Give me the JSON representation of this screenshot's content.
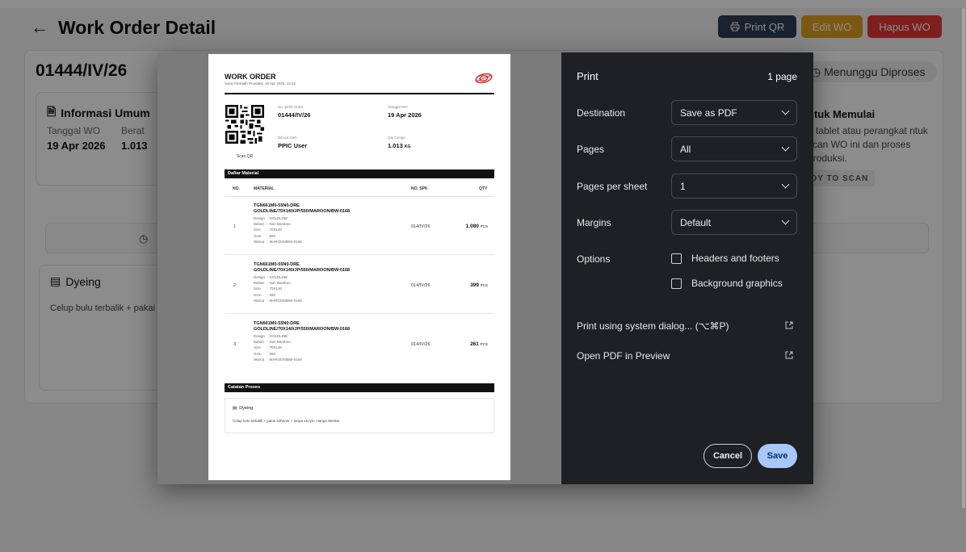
{
  "app": {
    "title": "Work Order Detail",
    "buttons": {
      "print_qr": "Print QR",
      "edit": "Edit WO",
      "hapus": "Hapus WO"
    },
    "wo_number": "01444/IV/26",
    "status": "Menunggu Diproses",
    "info": {
      "title": "Informasi Umum",
      "tanggal_label": "Tanggal WO",
      "tanggal_value": "19 Apr 2026",
      "berat_label": "Berat",
      "berat_value": "1.013"
    },
    "scan_card": {
      "title": "ntuk Memulai",
      "desc": "n tablet atau perangkat ntuk scan WO ini dan proses produksi.",
      "ready": "DY TO SCAN"
    },
    "dyeing": {
      "title": "Dyeing",
      "desc": "Celup bulu terbalik + pakai"
    }
  },
  "sheet": {
    "title": "WORK ORDER",
    "subtitle": "Surat Perintah Produksi, 19 Apr 2026, 13.22",
    "scan_label": "Scan QR",
    "no_wo_label": "No. Work Order",
    "no_wo_value": "01444/IV/26",
    "tanggal_label": "Tanggal WO",
    "tanggal_value": "19 Apr 2026",
    "dibuat_label": "Dibuat Oleh",
    "dibuat_value": "PPIC User",
    "qty_label": "Qty Greige",
    "qty_value": "1.013",
    "qty_unit": "KG",
    "material_section": "Daftar Material",
    "columns": {
      "no": "NO.",
      "material": "MATERIAL",
      "spk": "NO. SPK",
      "qty": "QTY"
    },
    "attr_keys": {
      "design": "Design",
      "bahan": "Bahan",
      "size": "Size",
      "gsm": "Gsm",
      "warna": "Warna"
    },
    "rows": [
      {
        "no": "1",
        "code": "TGN661M0-55N0-DRE",
        "desc": "GOLDLINE/70X140/JP/550/MAROON/BW-0168",
        "design": ": GOLDLINE",
        "bahan": ": Non Bamboo",
        "size": ": 70X140",
        "gsm": ": 550",
        "warna": ": MAROON/BW-0168",
        "spk": "014/IV/26",
        "qty": "1.080",
        "unit": "PCS"
      },
      {
        "no": "2",
        "code": "TGN661M0-55N0-DRE",
        "desc": "GOLDLINE/70X140/JP/550/MAROON/BW-0168",
        "design": ": GOLDLINE",
        "bahan": ": Non Bamboo",
        "size": ": 70X140",
        "gsm": ": 550",
        "warna": ": MAROON/BW-0168",
        "spk": "014/IV/26",
        "qty": "399",
        "unit": "PCS"
      },
      {
        "no": "3",
        "code": "TGN661M0-55N0-DRE",
        "desc": "GOLDLINE/70X140/JP/550/MAROON/BW-0168",
        "design": ": GOLDLINE",
        "bahan": ": Non Bamboo",
        "size": ": 70X140",
        "gsm": ": 550",
        "warna": ": MAROON/BW-0168",
        "spk": "014/IV/26",
        "qty": "261",
        "unit": "PCS"
      }
    ],
    "notes_section": "Catatan Proses",
    "note_title": "Dyeing",
    "note_desc": "Celup bulu terbalik + pakai softener + tanpa enzym +tanpa Stenter"
  },
  "print": {
    "title": "Print",
    "page_count": "1 page",
    "destination_label": "Destination",
    "destination_value": "Save as PDF",
    "pages_label": "Pages",
    "pages_value": "All",
    "pps_label": "Pages per sheet",
    "pps_value": "1",
    "margins_label": "Margins",
    "margins_value": "Default",
    "options_label": "Options",
    "opt_headers": "Headers and footers",
    "opt_background": "Background graphics",
    "headers_checked": false,
    "background_checked": false,
    "system_dialog": "Print using system dialog... (⌥⌘P)",
    "open_preview": "Open PDF in Preview",
    "cancel": "Cancel",
    "save": "Save"
  },
  "colors": {
    "btn_print_qr": "#2f3e55",
    "btn_edit": "#e0a020",
    "btn_hapus": "#e53935",
    "dialog_bg": "#1f2023",
    "save_btn": "#a8c7fa",
    "logo_red": "#d32f2f"
  }
}
